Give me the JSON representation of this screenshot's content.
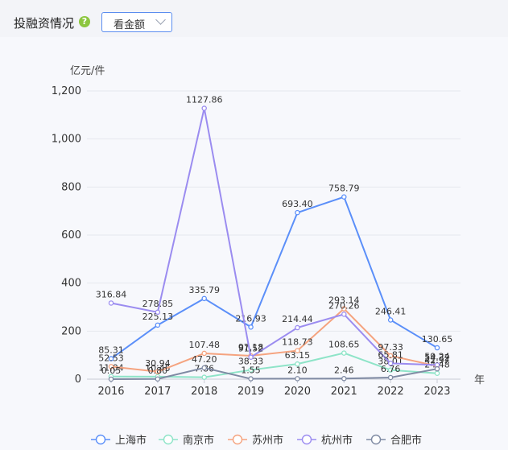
{
  "header": {
    "title": "投融资情况",
    "help_icon": "question-circle-icon",
    "select": {
      "value": "看金额"
    }
  },
  "chart_data": {
    "type": "line",
    "y_unit_label": "亿元/件",
    "x_unit_label": "年",
    "categories": [
      "2016",
      "2017",
      "2018",
      "2019",
      "2020",
      "2021",
      "2022",
      "2023"
    ],
    "ylim": [
      0,
      1200
    ],
    "yticks": [
      0,
      200,
      400,
      600,
      800,
      1000,
      1200
    ],
    "ytick_labels": [
      "0",
      "200",
      "400",
      "600",
      "800",
      "1,000",
      "1,200"
    ],
    "grid": true,
    "legend_position": "bottom",
    "series": [
      {
        "name": "上海市",
        "color": "#5b8ff9",
        "values": [
          85.31,
          225.13,
          335.79,
          216.93,
          693.4,
          758.79,
          246.41,
          130.65
        ],
        "labels": [
          "85.31",
          "225.13",
          "335.79",
          "216.93",
          "693.40",
          "758.79",
          "246.41",
          "130.65"
        ]
      },
      {
        "name": "南京市",
        "color": "#8ee4c8",
        "values": [
          11.04,
          10.45,
          7.86,
          38.33,
          63.15,
          108.65,
          38.01,
          24.48
        ],
        "labels": [
          "11.04",
          "10.45",
          "7.86",
          "38.33",
          "63.15",
          "108.65",
          "38.01",
          "24.48"
        ]
      },
      {
        "name": "苏州市",
        "color": "#f5a37f",
        "values": [
          52.53,
          30.94,
          107.48,
          97.18,
          118.73,
          293.14,
          97.33,
          54.32
        ],
        "labels": [
          "52.53",
          "30.94",
          "107.48",
          "97.18",
          "118.73",
          "293.14",
          "97.33",
          "54.32"
        ]
      },
      {
        "name": "杭州市",
        "color": "#9b8cf0",
        "values": [
          316.84,
          278.85,
          1127.86,
          91.52,
          214.44,
          270.26,
          65.81,
          59.24
        ],
        "labels": [
          "316.84",
          "278.85",
          "1127.86",
          "91.52",
          "214.44",
          "270.26",
          "65.81",
          "59.24"
        ]
      },
      {
        "name": "合肥市",
        "color": "#7f8aa3",
        "values": [
          0.05,
          0.8,
          47.2,
          1.55,
          2.1,
          2.46,
          6.76,
          42.97
        ],
        "labels": [
          "0.05",
          "0.80",
          "47.20",
          "1.55",
          "2.10",
          "2.46",
          "6.76",
          "42.97"
        ]
      }
    ]
  }
}
